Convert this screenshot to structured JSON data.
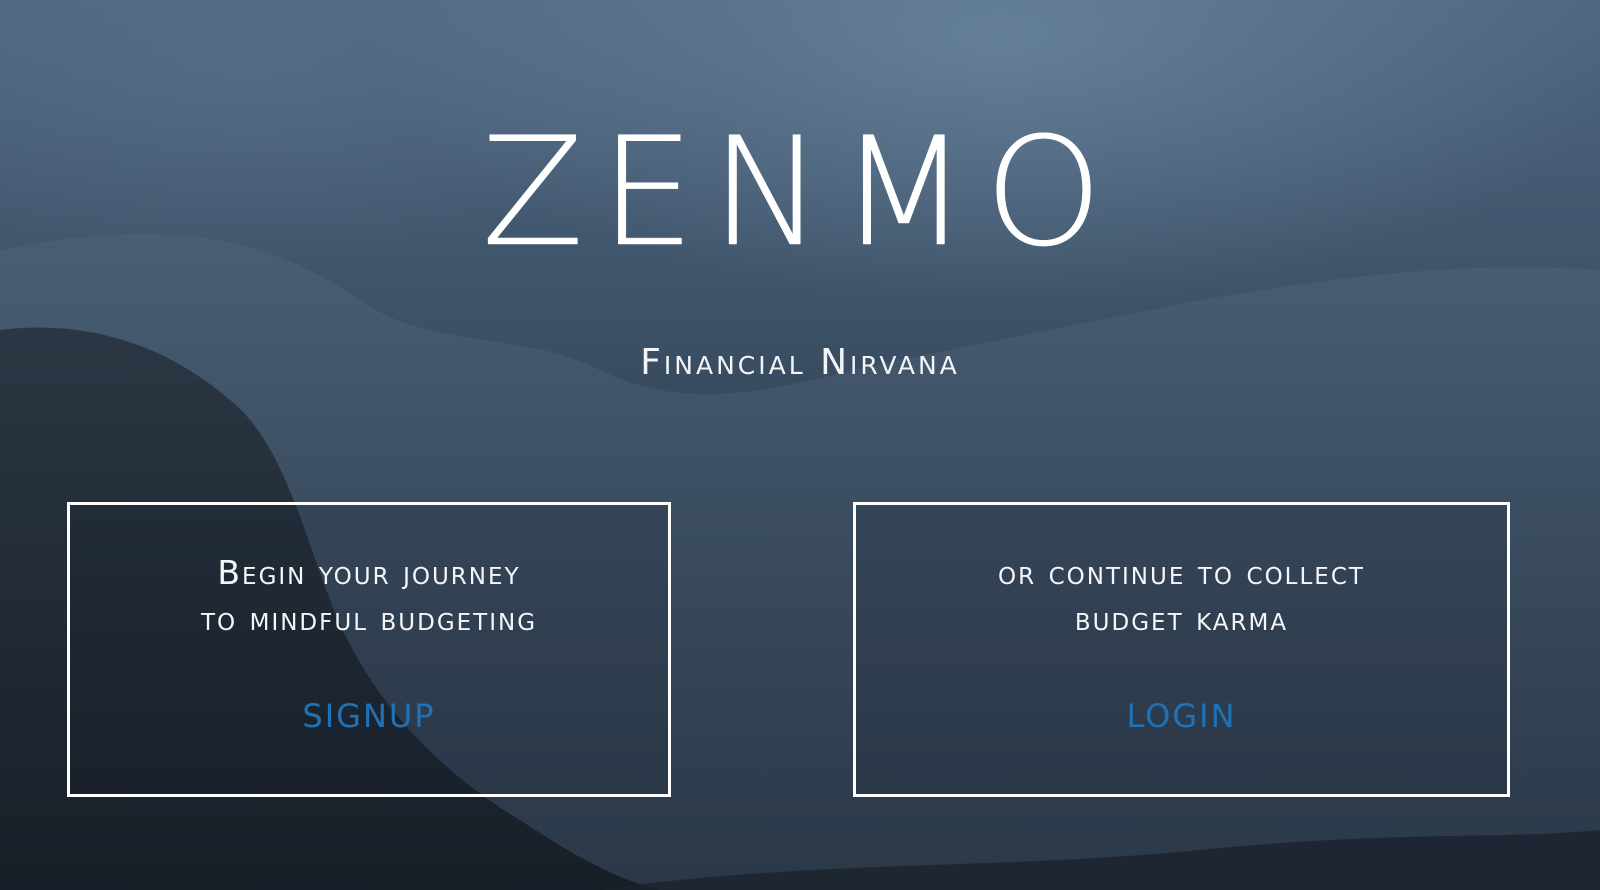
{
  "brand": {
    "title": "ZENMO",
    "tagline": "Financial Nirvana"
  },
  "signup_card": {
    "line1": "Begin your journey",
    "line2": "to mindful budgeting",
    "action_label": "SIGNUP"
  },
  "login_card": {
    "line1": "or continue to collect",
    "line2": "budget karma",
    "action_label": "LOGIN"
  },
  "colors": {
    "link": "#1f72b8",
    "text": "#ffffff",
    "border": "#ffffff",
    "background": "#3d5268"
  }
}
